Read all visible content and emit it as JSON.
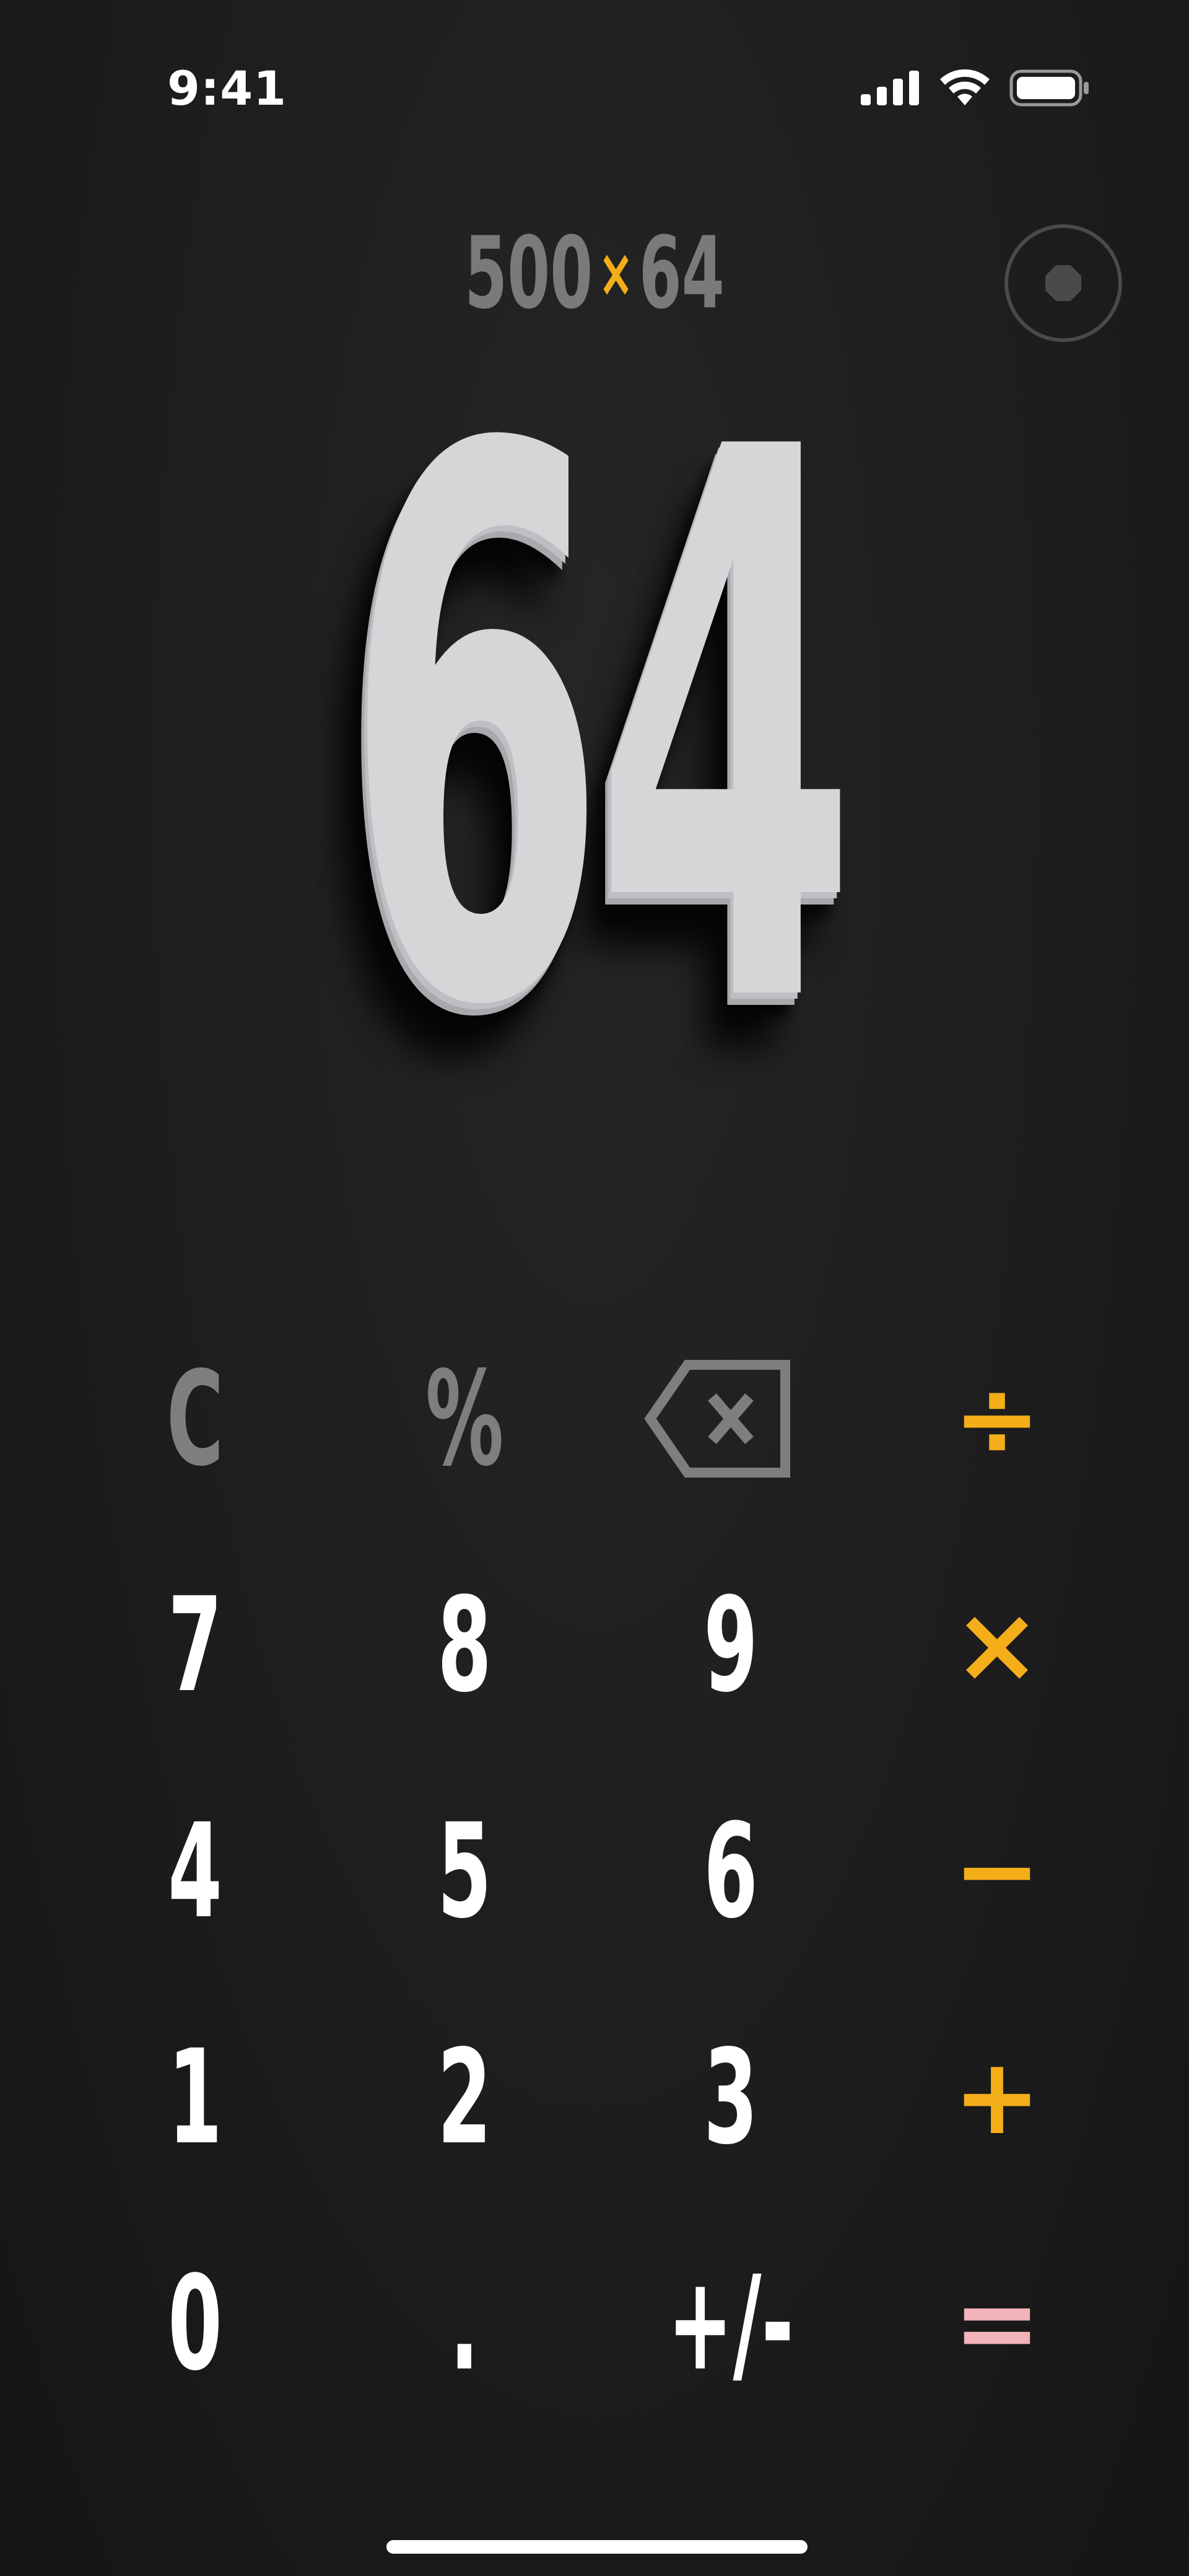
{
  "status_bar": {
    "time": "9:41",
    "icons": [
      "cellular-signal-icon",
      "wifi-icon",
      "battery-icon"
    ]
  },
  "display": {
    "expression_left": "500",
    "expression_operator": "×",
    "expression_right": "64",
    "result": "64"
  },
  "record_button": {
    "icon": "record-icon"
  },
  "keypad": {
    "rows": [
      [
        {
          "label": "C",
          "kind": "func"
        },
        {
          "label": "%",
          "kind": "func"
        },
        {
          "label": "",
          "kind": "func",
          "icon": "backspace-icon"
        },
        {
          "label": "÷",
          "kind": "op"
        }
      ],
      [
        {
          "label": "7",
          "kind": "digit"
        },
        {
          "label": "8",
          "kind": "digit"
        },
        {
          "label": "9",
          "kind": "digit"
        },
        {
          "label": "×",
          "kind": "op"
        }
      ],
      [
        {
          "label": "4",
          "kind": "digit"
        },
        {
          "label": "5",
          "kind": "digit"
        },
        {
          "label": "6",
          "kind": "digit"
        },
        {
          "label": "−",
          "kind": "op"
        }
      ],
      [
        {
          "label": "1",
          "kind": "digit"
        },
        {
          "label": "2",
          "kind": "digit"
        },
        {
          "label": "3",
          "kind": "digit"
        },
        {
          "label": "+",
          "kind": "op"
        }
      ],
      [
        {
          "label": "0",
          "kind": "digit"
        },
        {
          "label": ".",
          "kind": "digit"
        },
        {
          "label": "+/-",
          "kind": "digit"
        },
        {
          "label": "=",
          "kind": "eq"
        }
      ]
    ]
  },
  "colors": {
    "background": "#1c1c1c",
    "digit": "#ffffff",
    "function": "#7e7e7e",
    "operator": "#f4ae1a",
    "equals": "#f2b3b9",
    "result": "#d6d5d8"
  }
}
